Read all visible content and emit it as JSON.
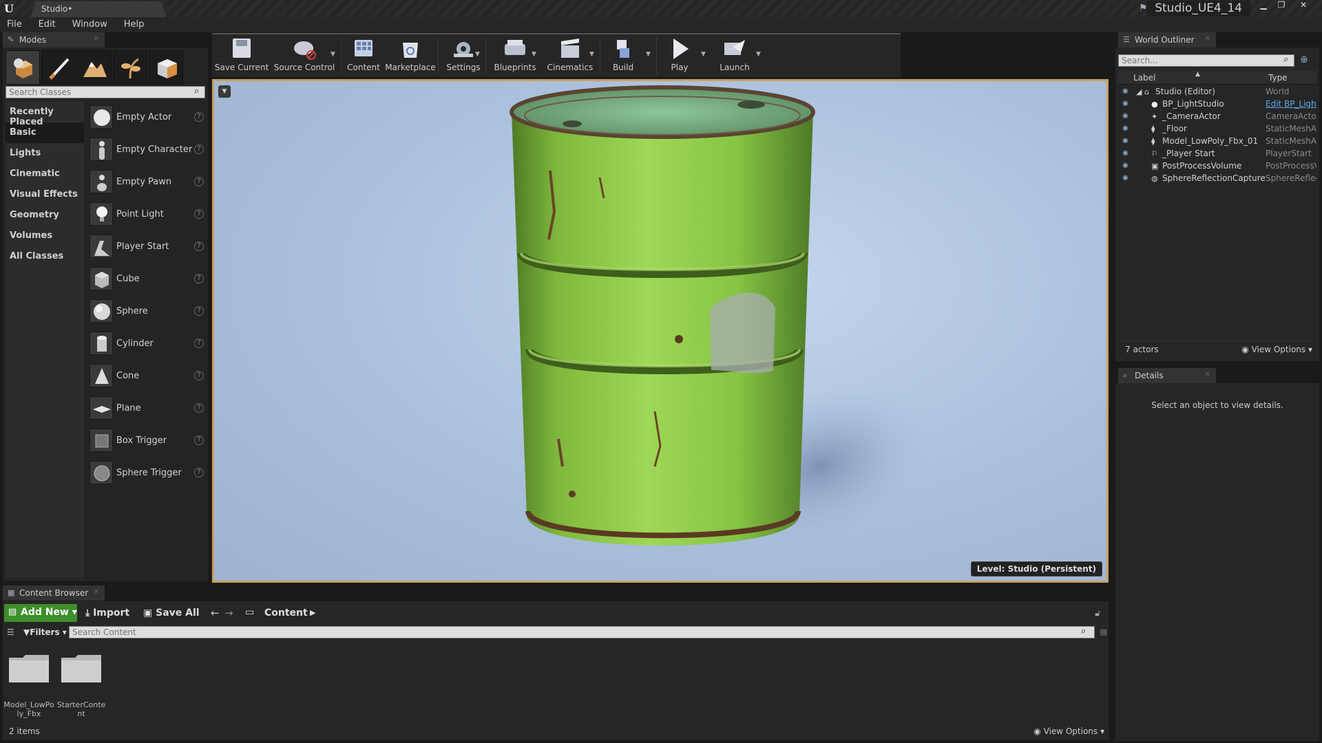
{
  "titlebar": {
    "doc_tab": "Studio•",
    "project_name": "Studio_UE4_14",
    "minimize": "▁",
    "maximize": "❐",
    "close": "✕"
  },
  "menu": [
    "File",
    "Edit",
    "Window",
    "Help"
  ],
  "modes": {
    "tab_label": "Modes",
    "search_placeholder": "Search Classes",
    "categories": [
      "Recently Placed",
      "Basic",
      "Lights",
      "Cinematic",
      "Visual Effects",
      "Geometry",
      "Volumes",
      "All Classes"
    ],
    "active_category": "Basic",
    "items": [
      "Empty Actor",
      "Empty Character",
      "Empty Pawn",
      "Point Light",
      "Player Start",
      "Cube",
      "Sphere",
      "Cylinder",
      "Cone",
      "Plane",
      "Box Trigger",
      "Sphere Trigger"
    ],
    "help_glyph": "?"
  },
  "toolbar": {
    "buttons": [
      "Save Current",
      "Source Control",
      "Content",
      "Marketplace",
      "Settings",
      "Blueprints",
      "Cinematics",
      "Build",
      "Play",
      "Launch"
    ]
  },
  "viewport": {
    "level_label": "Level:  Studio (Persistent)"
  },
  "outliner": {
    "tab_label": "World Outliner",
    "search_placeholder": "Search...",
    "col_label": "Label",
    "col_type": "Type",
    "rows": [
      {
        "label": "Studio (Editor)",
        "type": "World"
      },
      {
        "label": "BP_LightStudio",
        "type": "Edit BP_LightStudio"
      },
      {
        "label": "_CameraActor",
        "type": "CameraActor"
      },
      {
        "label": "_Floor",
        "type": "StaticMeshActor"
      },
      {
        "label": "Model_LowPoly_Fbx_01",
        "type": "StaticMeshActor"
      },
      {
        "label": "_Player Start",
        "type": "PlayerStart"
      },
      {
        "label": "PostProcessVolume",
        "type": "PostProcessVolume"
      },
      {
        "label": "SphereReflectionCapture",
        "type": "SphereReflectionCapture"
      }
    ],
    "actor_count": "7 actors",
    "view_options": "View Options"
  },
  "details": {
    "tab_label": "Details",
    "empty_message": "Select an object to view details."
  },
  "content_browser": {
    "tab_label": "Content Browser",
    "add_new": "Add New",
    "import": "Import",
    "save_all": "Save All",
    "path": "Content",
    "filters": "Filters",
    "search_placeholder": "Search Content",
    "folders": [
      "Model_LowPoly_Fbx",
      "StarterContent"
    ],
    "item_count": "2 items",
    "view_options": "View Options"
  },
  "colors": {
    "accent_viewport_border": "#c8a060",
    "add_new_green": "#3c8f2a",
    "link_blue": "#5aaaf0",
    "barrel_green": "#8fce4a"
  }
}
